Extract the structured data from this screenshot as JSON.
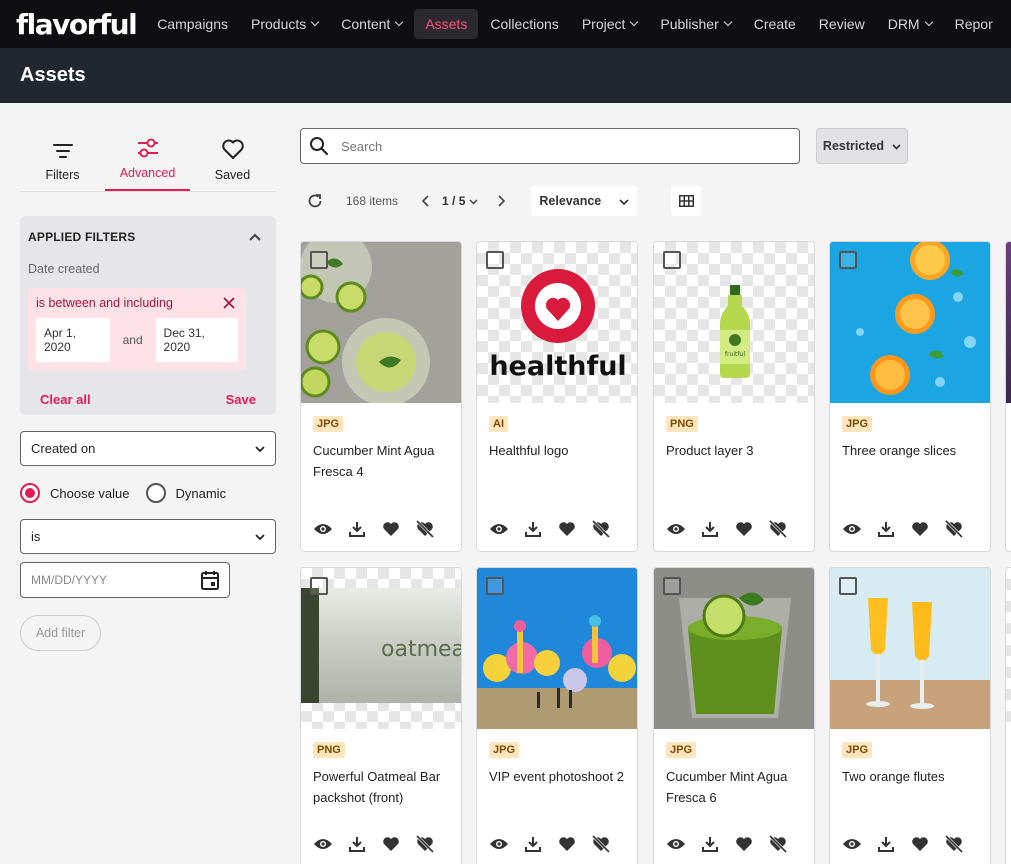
{
  "brand": {
    "logo": "flavorful",
    "accent": "#e11d54"
  },
  "nav": {
    "items": [
      {
        "label": "Campaigns",
        "has_dropdown": false,
        "active": false
      },
      {
        "label": "Products",
        "has_dropdown": true,
        "active": false
      },
      {
        "label": "Content",
        "has_dropdown": true,
        "active": false
      },
      {
        "label": "Assets",
        "has_dropdown": false,
        "active": true
      },
      {
        "label": "Collections",
        "has_dropdown": false,
        "active": false
      },
      {
        "label": "Project",
        "has_dropdown": true,
        "active": false
      },
      {
        "label": "Publisher",
        "has_dropdown": true,
        "active": false
      },
      {
        "label": "Create",
        "has_dropdown": false,
        "active": false
      },
      {
        "label": "Review",
        "has_dropdown": false,
        "active": false
      },
      {
        "label": "DRM",
        "has_dropdown": true,
        "active": false
      },
      {
        "label": "Repor",
        "has_dropdown": false,
        "active": false
      }
    ]
  },
  "page": {
    "title": "Assets"
  },
  "sidebar": {
    "tabs": [
      {
        "label": "Filters",
        "icon": "filter-lines-icon",
        "active": false
      },
      {
        "label": "Advanced",
        "icon": "sliders-icon",
        "active": true
      },
      {
        "label": "Saved",
        "icon": "heart-outline-icon",
        "active": false
      }
    ],
    "applied": {
      "title": "APPLIED FILTERS",
      "field": "Date created",
      "condition": "is between and including",
      "from": "Apr 1, 2020",
      "joiner": "and",
      "to": "Dec 31, 2020",
      "clear_label": "Clear all",
      "save_label": "Save"
    },
    "field_select": "Created on",
    "radio": {
      "choose": "Choose value",
      "dynamic": "Dynamic",
      "selected": "choose"
    },
    "operator_select": "is",
    "date_placeholder": "MM/DD/YYYY",
    "add_filter": "Add filter"
  },
  "search": {
    "placeholder": "Search"
  },
  "restricted": {
    "label": "Restricted"
  },
  "toolbar": {
    "count": "168 items",
    "page": "1 / 5",
    "sort": "Relevance"
  },
  "assets": [
    {
      "type": "JPG",
      "title": "Cucumber Mint Agua Fresca 4"
    },
    {
      "type": "AI",
      "title": "Healthful logo"
    },
    {
      "type": "PNG",
      "title": "Product layer 3"
    },
    {
      "type": "JPG",
      "title": "Three orange slices"
    },
    {
      "type": "PNG",
      "title": "Powerful Oatmeal Bar packshot (front)"
    },
    {
      "type": "JPG",
      "title": "VIP event photoshoot 2"
    },
    {
      "type": "JPG",
      "title": "Cucumber Mint Agua Fresca 6"
    },
    {
      "type": "JPG",
      "title": "Two orange flutes"
    }
  ],
  "artwork": {
    "logo_word": "healthful",
    "bottle_label": "fruitful",
    "oat_word": "oatmea"
  }
}
